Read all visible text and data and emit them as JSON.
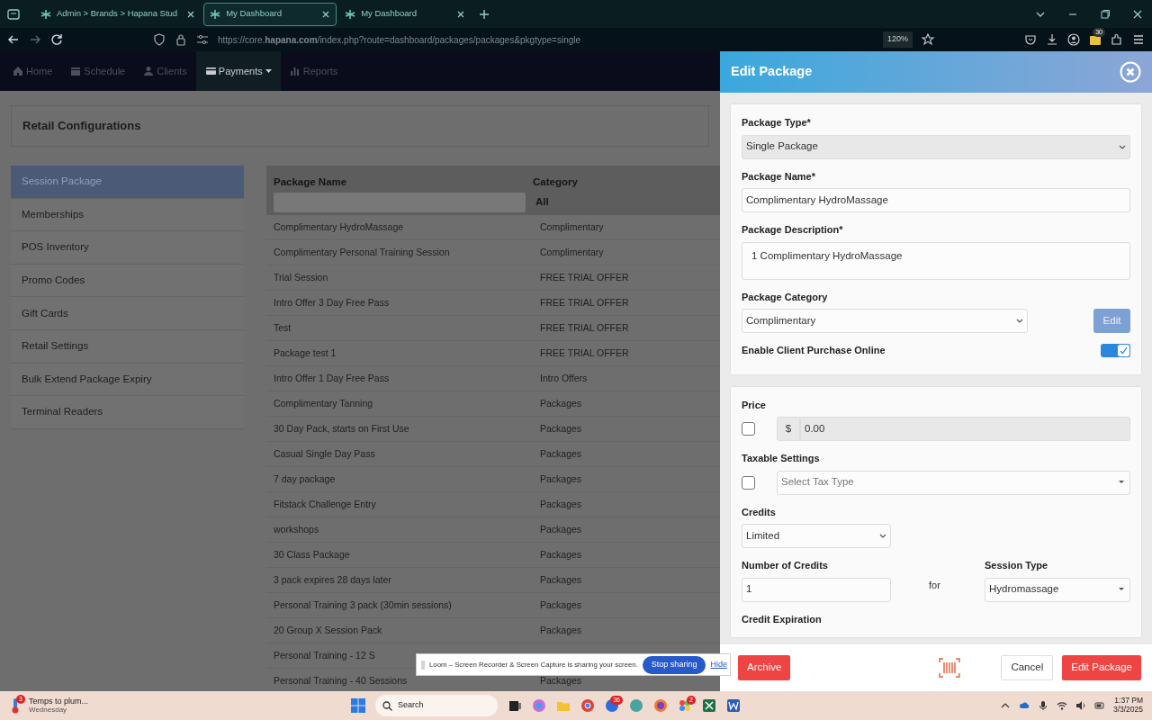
{
  "browser": {
    "tabs": [
      {
        "label": "Admin > Brands > Hapana Stud",
        "selected": false
      },
      {
        "label": "My Dashboard",
        "selected": true
      },
      {
        "label": "My Dashboard",
        "selected": false
      }
    ],
    "url": "https://core.**hapana.com**/index.php?route=dashboard/packages/packages&pkgtype=single",
    "zoom": "120%",
    "extension_badge": "30"
  },
  "nav": {
    "items": [
      {
        "label": "Home",
        "selected": false,
        "has_menu": false
      },
      {
        "label": "Schedule",
        "selected": false,
        "has_menu": false
      },
      {
        "label": "Clients",
        "selected": false,
        "has_menu": false
      },
      {
        "label": "Payments",
        "selected": true,
        "has_menu": true
      },
      {
        "label": "Reports",
        "selected": false,
        "has_menu": false
      }
    ]
  },
  "page_title": "Retail Configurations",
  "sidebar": {
    "items": [
      {
        "label": "Session Package",
        "selected": true
      },
      {
        "label": "Memberships",
        "selected": false
      },
      {
        "label": "POS Inventory",
        "selected": false
      },
      {
        "label": "Promo Codes",
        "selected": false
      },
      {
        "label": "Gift Cards",
        "selected": false
      },
      {
        "label": "Retail Settings",
        "selected": false
      },
      {
        "label": "Bulk Extend Package Expiry",
        "selected": false
      },
      {
        "label": "Terminal Readers",
        "selected": false
      }
    ]
  },
  "table": {
    "columns": [
      "Package Name",
      "Category"
    ],
    "category_filter": "All",
    "rows": [
      {
        "name": "Complimentary HydroMassage",
        "category": "Complimentary"
      },
      {
        "name": "Complimentary Personal Training Session",
        "category": "Complimentary"
      },
      {
        "name": "Trial Session",
        "category": "FREE TRIAL OFFER"
      },
      {
        "name": "Intro Offer 3 Day Free Pass",
        "category": "FREE TRIAL OFFER"
      },
      {
        "name": "Test",
        "category": "FREE TRIAL OFFER"
      },
      {
        "name": "Package test 1",
        "category": "FREE TRIAL OFFER"
      },
      {
        "name": "Intro Offer 1 Day Free Pass",
        "category": "Intro Offers"
      },
      {
        "name": "Complimentary Tanning",
        "category": "Packages"
      },
      {
        "name": "30 Day Pack, starts on First Use",
        "category": "Packages"
      },
      {
        "name": "Casual Single Day Pass",
        "category": "Packages"
      },
      {
        "name": "7 day package",
        "category": "Packages"
      },
      {
        "name": "Fitstack Challenge Entry",
        "category": "Packages"
      },
      {
        "name": "workshops",
        "category": "Packages"
      },
      {
        "name": "30 Class Package",
        "category": "Packages"
      },
      {
        "name": "3 pack expires 28 days later",
        "category": "Packages"
      },
      {
        "name": "Personal Training 3 pack (30min sessions)",
        "category": "Packages"
      },
      {
        "name": "20 Group X Session Pack",
        "category": "Packages"
      },
      {
        "name": "Personal Training - 12 S"
      },
      {
        "name": "Personal Training - 40 Sessions",
        "category": "Packages"
      }
    ]
  },
  "drawer": {
    "title": "Edit Package",
    "package_type": {
      "label": "Package Type*",
      "value": "Single Package"
    },
    "package_name": {
      "label": "Package Name*",
      "value": "Complimentary HydroMassage"
    },
    "package_description": {
      "label": "Package Description*",
      "value": "1 Complimentary HydroMassage"
    },
    "package_category": {
      "label": "Package Category",
      "value": "Complimentary",
      "edit_button": "Edit"
    },
    "enable_online": {
      "label": "Enable Client Purchase Online",
      "on": true
    },
    "price": {
      "label": "Price",
      "checked": false,
      "currency": "$",
      "value": "0.00"
    },
    "taxable": {
      "label": "Taxable Settings",
      "checked": false,
      "placeholder": "Select Tax Type"
    },
    "credits": {
      "label": "Credits",
      "value": "Limited"
    },
    "number_of_credits": {
      "label": "Number of Credits",
      "value": "1"
    },
    "connector": "for",
    "session_type": {
      "label": "Session Type",
      "value": "Hydromassage"
    },
    "credit_expiration": {
      "label": "Credit Expiration"
    },
    "footer": {
      "archive": "Archive",
      "cancel": "Cancel",
      "submit": "Edit Package"
    }
  },
  "loom_bar": {
    "message": "Loom – Screen Recorder & Screen Capture is sharing your screen.",
    "stop_button": "Stop sharing",
    "hide_link": "Hide"
  },
  "taskbar": {
    "weather": {
      "text": "Temps to plum...",
      "subtext": "Wednesday",
      "badge": "3"
    },
    "search_placeholder": "Search",
    "app_badges": [
      "36",
      "2"
    ],
    "time": "1:37 PM",
    "date": "3/3/2025"
  }
}
